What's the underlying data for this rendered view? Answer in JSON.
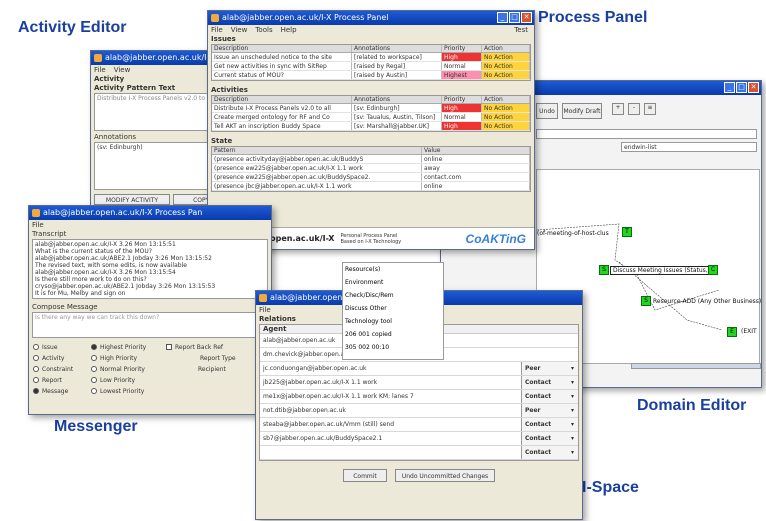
{
  "captions": {
    "activity_editor": "Activity Editor",
    "process_panel": "Process Panel",
    "domain_editor": "Domain Editor",
    "messenger": "Messenger",
    "ispace": "I-Space"
  },
  "colors": {
    "caption": "#1a3f9e",
    "titlebar": "#1d5bd6",
    "node": "#23d423"
  },
  "process_panel": {
    "title": "alab@jabber.open.ac.uk/I-X Process Panel",
    "menu": [
      "File",
      "View",
      "Tools",
      "Help"
    ],
    "menu_right": "Test",
    "issues_label": "Issues",
    "issue_headers": [
      "Description",
      "Annotations",
      "Priority",
      "Action"
    ],
    "issues": [
      {
        "d": "Issue an unscheduled notice to the site",
        "a": "[related to workspace]",
        "p": "High",
        "s": "No Action"
      },
      {
        "d": "Get new activities in sync with SitRep",
        "a": "[raised by Regal]",
        "p": "Normal",
        "s": "No Action"
      },
      {
        "d": "Current status of MOU?",
        "a": "[raised by Austin]",
        "p": "Highest",
        "s": "No Action"
      }
    ],
    "activities_label": "Activities",
    "activity_headers": [
      "Description",
      "Annotations",
      "Priority",
      "Action"
    ],
    "activities": [
      {
        "d": "Distribute I-X Process Panels v2.0 to all",
        "a": "[sv: Edinburgh]",
        "p": "High",
        "s": "No Action"
      },
      {
        "d": "Create merged ontology for RF and Co",
        "a": "[sv: Taualus, Austin, Tilson]",
        "p": "Normal",
        "s": "No Action"
      },
      {
        "d": "Tell AKT an inscription Buddy Space",
        "a": "[sv: Marshall@jabber.UK]",
        "p": "High",
        "s": "No Action"
      }
    ],
    "state_label": "State",
    "state_headers": [
      "Pattern",
      "Value"
    ],
    "state_rows": [
      {
        "p": "(presence activityday@jabber.open.ac.uk/BuddyS",
        "v": "online"
      },
      {
        "p": "(presence ew225@jabber.open.ac.uk/I-X 1.1 work",
        "v": "away"
      },
      {
        "p": "(presence ew225@jabber.open.ac.uk/BuddySpace2.",
        "v": "contact.com"
      },
      {
        "p": "(presence jbc@jabber.open.ac.uk/I-X 1.1 work",
        "v": "online"
      }
    ],
    "footer_id": "alab@jabber.open.ac.uk/I-X",
    "footer_sub1": "Personal Process Panel",
    "footer_sub2": "Based on I-X Technology",
    "logo": "CoAKTinG"
  },
  "activity_editor": {
    "title": "alab@jabber.open.ac.uk/I-X Process Panel",
    "menu": [
      "File",
      "View"
    ],
    "activity_label": "Activity",
    "pattern_label": "Activity Pattern Text",
    "pattern_value": "Distribute I-X Process Panels v2.0 to all",
    "annotations_label": "Annotations",
    "annotations_value": "(sv: Edinburgh)",
    "modify_button": "MODIFY ACTIVITY",
    "copy_button": "COPY ACT"
  },
  "messenger": {
    "title": "alab@jabber.open.ac.uk/I-X Process Pan",
    "menu": [
      "File"
    ],
    "transcript_label": "Transcript",
    "transcript": [
      "alab@jabber.open.ac.uk/I-X 3.26 Mon 13:15:51",
      "   What is the current status of the MOU?",
      "alab@jabber.open.ac.uk/ABE2.1 Jobday 3:26 Mon 13:15:52",
      "   The revised text, with some edits, is now available",
      "alab@jabber.open.ac.uk/I-X 3.26 Mon 13:15:54",
      "   Is there still more work to do on this?",
      "cryso@jabber.open.ac.uk/ABE2.1 Jobday 3:26 Mon 13:15:53",
      "   It is for Mu, Melby and sign on"
    ],
    "compose_label": "Compose Message",
    "compose_placeholder": "Is there any way we can track this down?",
    "col1": [
      "Issue",
      "Activity",
      "Constraint",
      "Report",
      "Message"
    ],
    "col1_selected": "Message",
    "col2": [
      "Highest Priority",
      "High Priority",
      "Normal Priority",
      "Low Priority",
      "Lowest Priority"
    ],
    "col2_selected": "Highest Priority",
    "report_back": "Report Back",
    "ref_label": "Ref",
    "report_type": "Report Type",
    "recipient": "Recipient"
  },
  "domain_editor": {
    "buttons": [
      "Undo",
      "Modify Draft"
    ],
    "path_text": "endwin-list",
    "node_labels": [
      "(of-meeting-of-host-clus",
      "Discuss Meeting Issues (Status,",
      "Resource-ADD (Any Other Business)",
      "(EXIT"
    ],
    "tree_items": [
      "Resource(s)",
      "Environment",
      "Check/Disc/Rem",
      "Discuss Other",
      "Technology tool",
      "206 001 copied",
      "305 002 00:10"
    ]
  },
  "ispace": {
    "title": "alab@jabber.open.ac.uk/I",
    "menu": [
      "File"
    ],
    "relations_label": "Relations",
    "agent_label": "Agent",
    "agents": [
      {
        "a": "alab@jabber.open.ac.uk",
        "r": ""
      },
      {
        "a": "dm.chevick@jabber.open.ac.uk",
        "r": ""
      },
      {
        "a": "jc.conduongan@jabber.open.ac.uk",
        "r": "Peer"
      },
      {
        "a": "jb225@jabber.open.ac.uk/I-X 1.1 work",
        "r": "Contact"
      },
      {
        "a": "me1x@jabber.open.ac.uk/I-X 1.1 work KM: lanes 7",
        "r": "Contact"
      },
      {
        "a": "not.dtib@jabber.open.ac.uk",
        "r": "Peer"
      },
      {
        "a": "steaba@jabber.open.ac.uk/Vmm (still) send",
        "r": "Contact"
      },
      {
        "a": "sb7@jabber.open.ac.uk/BuddySpace2.1",
        "r": "Contact"
      },
      {
        "a": "",
        "r": "Contact"
      }
    ],
    "commit_button": "Commit",
    "undo_button": "Undo Uncommitted Changes"
  }
}
